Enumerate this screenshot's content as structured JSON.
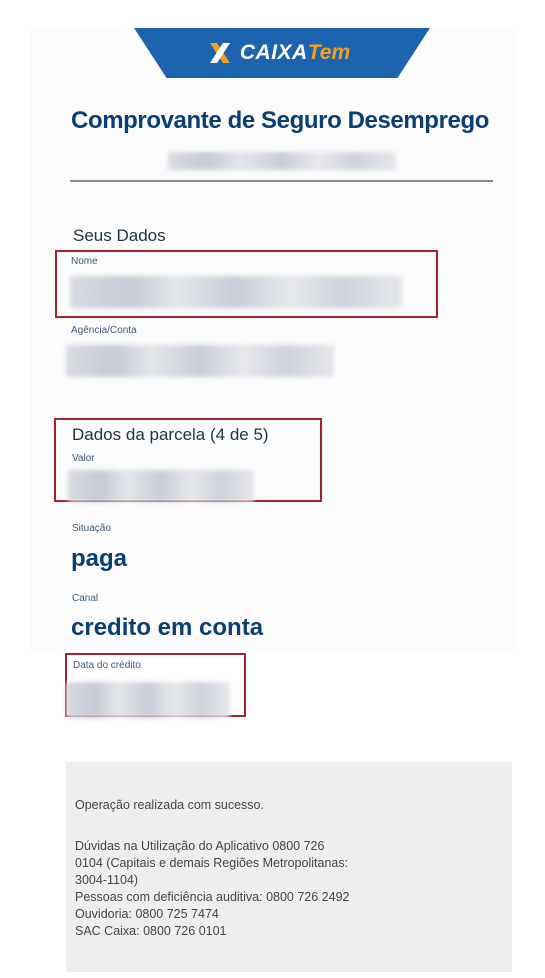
{
  "brand": {
    "name_primary": "CAIXA",
    "name_secondary": "Tem",
    "colors": {
      "blue": "#1c63b0",
      "orange": "#f6a01a",
      "title": "#0b3e73",
      "highlight": "#a5222f"
    }
  },
  "header": {
    "title": "Comprovante de Seguro Desemprego"
  },
  "dados": {
    "section_title": "Seus Dados",
    "nome_label": "Nome",
    "agencia_label": "Agência/Conta"
  },
  "parcela": {
    "section_title": "Dados da parcela (4 de 5)",
    "valor_label": "Valor",
    "situacao_label": "Situação",
    "situacao_value": "paga",
    "canal_label": "Canal",
    "canal_value": "credito em conta",
    "data_label": "Data do crédito"
  },
  "footer": {
    "status": "Operação realizada com sucesso.",
    "lines": [
      "Dúvidas na Utilização do Aplicativo 0800 726",
      "0104 (Capitais e demais Regiões Metropolitanas:",
      "3004-1104)",
      "Pessoas com deficiência auditiva: 0800 726 2492",
      "Ouvidoria: 0800 725 7474",
      "SAC Caixa: 0800 726 0101"
    ]
  }
}
